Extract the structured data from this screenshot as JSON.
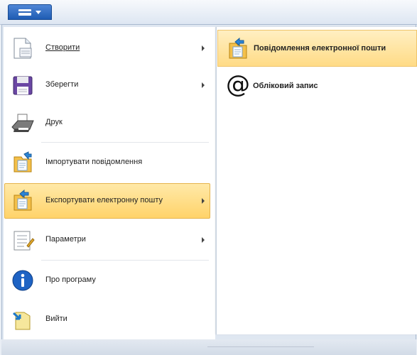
{
  "menu": {
    "items": [
      {
        "id": "create",
        "label": "Створити",
        "hotkey_index": 0,
        "has_submenu": true
      },
      {
        "id": "save",
        "label": "Зберегти",
        "hotkey_index": 0,
        "has_submenu": true
      },
      {
        "id": "print",
        "label": "Друк",
        "hotkey_index": 0,
        "has_submenu": false
      },
      {
        "id": "import",
        "label": "Імпортувати повідомлення",
        "hotkey_index": 0,
        "has_submenu": false
      },
      {
        "id": "export",
        "label": "Експортувати електронну пошту",
        "hotkey_index": 0,
        "has_submenu": true
      },
      {
        "id": "options",
        "label": "Параметри",
        "hotkey_index": 0,
        "has_submenu": true
      },
      {
        "id": "about",
        "label": "Про програму",
        "hotkey_index": 0,
        "has_submenu": false
      },
      {
        "id": "exit",
        "label": "Вийти",
        "hotkey_index": 0,
        "has_submenu": false
      }
    ]
  },
  "submenu": {
    "items": [
      {
        "id": "email-messages",
        "label": "Повідомлення електронної пошти"
      },
      {
        "id": "account",
        "label": "Обліковий запис"
      }
    ]
  },
  "colors": {
    "highlight": "#ffd36a",
    "highlight_border": "#e6b44c",
    "app_button": "#1e5cb3"
  }
}
